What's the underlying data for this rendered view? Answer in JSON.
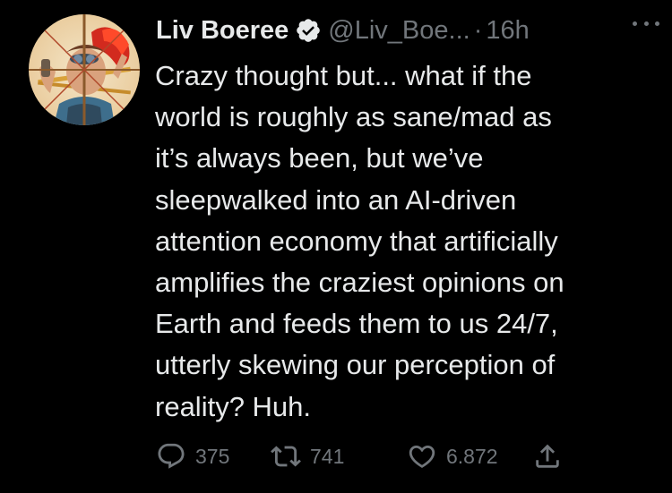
{
  "tweet": {
    "author": {
      "display_name": "Liv Boeree",
      "handle": "@Liv_Boe...",
      "verified": true
    },
    "separator": "·",
    "time": "16h",
    "text_lines": [
      "Crazy thought but... what if the",
      "world is roughly as sane/mad as",
      "it’s always been, but we’ve",
      "sleepwalked into an AI-driven",
      "attention economy that artificially",
      "amplifies the craziest opinions on",
      "Earth and feeds them to us 24/7,",
      "utterly skewing our perception of",
      "reality? Huh."
    ],
    "actions": {
      "replies": "375",
      "retweets": "741",
      "likes": "6.872"
    }
  },
  "icons": {
    "verified": "verified-badge-icon",
    "more": "more-horizontal-icon",
    "reply": "reply-bubble-icon",
    "retweet": "retweet-icon",
    "like": "heart-icon",
    "share": "share-icon"
  },
  "colors": {
    "background": "#000000",
    "text": "#e7e9ea",
    "muted": "#71767b"
  }
}
